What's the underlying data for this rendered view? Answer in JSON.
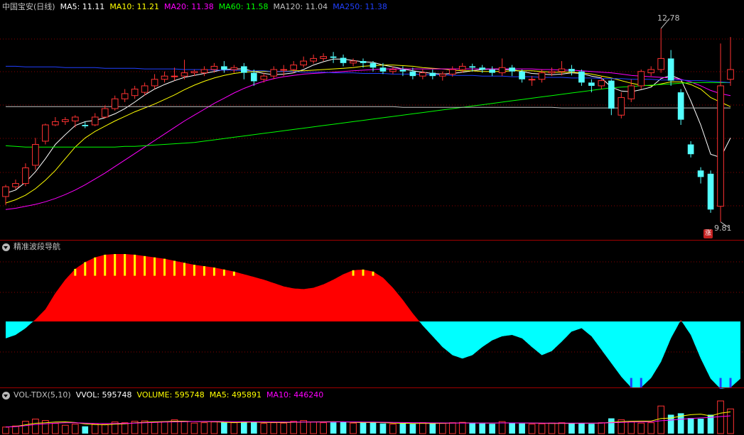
{
  "main_panel": {
    "title": "中国宝安(日线)",
    "ma_labels": [
      {
        "text": "MA5: 11.11",
        "color": "#ffffff"
      },
      {
        "text": "MA10: 11.21",
        "color": "#ffff00"
      },
      {
        "text": "MA20: 11.38",
        "color": "#ff00ff"
      },
      {
        "text": "MA60: 11.58",
        "color": "#00ff00"
      },
      {
        "text": "MA120: 11.04",
        "color": "#c0c0c0"
      },
      {
        "text": "MA250: 11.38",
        "color": "#2040ff"
      }
    ],
    "high_label": "12.78",
    "low_label": "9.81",
    "badge_text": "涨"
  },
  "indicator_panel": {
    "title": "精准波段导航"
  },
  "volume_panel": {
    "labels": [
      {
        "text": "VOL-TDX(5,10)",
        "color": "#c0c0c0"
      },
      {
        "text": "VVOL: 595748",
        "color": "#ffffff"
      },
      {
        "text": "VOLUME: 595748",
        "color": "#ffff00"
      },
      {
        "text": "MA5: 495891",
        "color": "#ffff00"
      },
      {
        "text": "MA10: 446240",
        "color": "#ff00ff"
      }
    ]
  },
  "colors": {
    "up": "#ff3232",
    "down": "#54ffff",
    "grid": "#8a0000",
    "wave_positive": "#ff0000",
    "wave_negative": "#00ffff",
    "wave_stripe_top": "#ffff00",
    "wave_stripe_bottom": "#1e3cff"
  },
  "chart_data": {
    "type": "candlestick",
    "ylim": [
      9.6,
      13.0
    ],
    "candles": [
      [
        10.2,
        10.35,
        10.38,
        10.07
      ],
      [
        10.35,
        10.4,
        10.46,
        10.31
      ],
      [
        10.4,
        10.64,
        10.71,
        10.36
      ],
      [
        10.68,
        11.0,
        11.1,
        10.61
      ],
      [
        11.05,
        11.3,
        11.32,
        11.0
      ],
      [
        11.3,
        11.35,
        11.42,
        11.28
      ],
      [
        11.35,
        11.38,
        11.42,
        11.3
      ],
      [
        11.36,
        11.42,
        11.45,
        11.26
      ],
      [
        11.3,
        11.28,
        11.35,
        11.25
      ],
      [
        11.3,
        11.42,
        11.48,
        11.28
      ],
      [
        11.42,
        11.55,
        11.6,
        11.4
      ],
      [
        11.55,
        11.7,
        11.75,
        11.52
      ],
      [
        11.7,
        11.78,
        11.85,
        11.65
      ],
      [
        11.75,
        11.85,
        11.9,
        11.7
      ],
      [
        11.8,
        11.9,
        11.95,
        11.75
      ],
      [
        11.9,
        12.0,
        12.08,
        11.85
      ],
      [
        12.0,
        12.05,
        12.12,
        11.95
      ],
      [
        12.05,
        12.05,
        12.18,
        11.98
      ],
      [
        12.05,
        12.1,
        12.3,
        12.0
      ],
      [
        12.1,
        12.12,
        12.15,
        12.05
      ],
      [
        12.1,
        12.15,
        12.2,
        12.05
      ],
      [
        12.15,
        12.2,
        12.25,
        12.1
      ],
      [
        12.2,
        12.15,
        12.28,
        12.1
      ],
      [
        12.15,
        12.18,
        12.22,
        12.1
      ],
      [
        12.2,
        12.1,
        12.25,
        12.0
      ],
      [
        12.1,
        11.97,
        12.15,
        11.9
      ],
      [
        12.0,
        12.05,
        12.1,
        11.95
      ],
      [
        12.05,
        12.15,
        12.2,
        12.0
      ],
      [
        12.15,
        12.15,
        12.22,
        12.05
      ],
      [
        12.15,
        12.22,
        12.28,
        12.1
      ],
      [
        12.22,
        12.28,
        12.35,
        12.18
      ],
      [
        12.28,
        12.32,
        12.38,
        12.24
      ],
      [
        12.32,
        12.35,
        12.4,
        12.28
      ],
      [
        12.35,
        12.33,
        12.42,
        12.25
      ],
      [
        12.33,
        12.25,
        12.38,
        12.2
      ],
      [
        12.25,
        12.28,
        12.32,
        12.2
      ],
      [
        12.28,
        12.25,
        12.32,
        12.18
      ],
      [
        12.25,
        12.18,
        12.28,
        12.12
      ],
      [
        12.18,
        12.12,
        12.25,
        12.08
      ],
      [
        12.12,
        12.15,
        12.2,
        12.08
      ],
      [
        12.15,
        12.12,
        12.2,
        12.05
      ],
      [
        12.12,
        12.05,
        12.18,
        12.0
      ],
      [
        12.05,
        12.1,
        12.15,
        12.0
      ],
      [
        12.1,
        12.05,
        12.15,
        12.0
      ],
      [
        12.05,
        12.08,
        12.12,
        11.98
      ],
      [
        12.08,
        12.15,
        12.2,
        12.04
      ],
      [
        12.15,
        12.2,
        12.25,
        12.1
      ],
      [
        12.2,
        12.18,
        12.24,
        12.12
      ],
      [
        12.18,
        12.15,
        12.22,
        12.1
      ],
      [
        12.15,
        12.1,
        12.2,
        12.05
      ],
      [
        12.1,
        12.18,
        12.32,
        12.05
      ],
      [
        12.18,
        12.12,
        12.22,
        12.05
      ],
      [
        12.12,
        12.0,
        12.15,
        11.95
      ],
      [
        12.0,
        12.0,
        12.05,
        11.9
      ],
      [
        12.0,
        12.1,
        12.15,
        11.95
      ],
      [
        12.1,
        12.12,
        12.18,
        12.05
      ],
      [
        12.12,
        12.16,
        12.28,
        12.06
      ],
      [
        12.16,
        12.12,
        12.22,
        12.06
      ],
      [
        12.12,
        11.95,
        12.15,
        11.9
      ],
      [
        11.95,
        11.9,
        12.0,
        11.8
      ],
      [
        11.9,
        11.98,
        12.05,
        11.85
      ],
      [
        11.98,
        11.55,
        12.0,
        11.45
      ],
      [
        11.45,
        11.72,
        11.8,
        11.4
      ],
      [
        11.7,
        11.9,
        12.0,
        11.65
      ],
      [
        11.9,
        12.12,
        12.15,
        11.85
      ],
      [
        12.1,
        12.15,
        12.2,
        12.05
      ],
      [
        12.15,
        12.32,
        12.78,
        12.1
      ],
      [
        12.32,
        11.98,
        12.45,
        11.9
      ],
      [
        11.8,
        11.38,
        11.85,
        11.3
      ],
      [
        11.0,
        10.85,
        11.05,
        10.8
      ],
      [
        10.6,
        10.5,
        10.65,
        10.4
      ],
      [
        10.55,
        10.0,
        10.6,
        9.95
      ],
      [
        10.05,
        11.9,
        12.55,
        9.81
      ],
      [
        12.0,
        12.15,
        12.65,
        11.9
      ]
    ],
    "ma_series": [
      {
        "name": "MA5",
        "color": "#ffffff",
        "values": [
          10.25,
          10.3,
          10.42,
          10.58,
          10.78,
          11.0,
          11.15,
          11.29,
          11.35,
          11.37,
          11.41,
          11.47,
          11.55,
          11.65,
          11.76,
          11.85,
          11.92,
          11.98,
          12.03,
          12.06,
          12.09,
          12.12,
          12.15,
          12.16,
          12.16,
          12.12,
          12.09,
          12.07,
          12.08,
          12.1,
          12.15,
          12.22,
          12.27,
          12.31,
          12.31,
          12.29,
          12.27,
          12.26,
          12.22,
          12.19,
          12.16,
          12.13,
          12.11,
          12.09,
          12.08,
          12.09,
          12.11,
          12.13,
          12.15,
          12.16,
          12.15,
          12.15,
          12.12,
          12.09,
          12.08,
          12.07,
          12.08,
          12.1,
          12.09,
          12.05,
          12.02,
          11.88,
          11.82,
          11.81,
          11.84,
          11.88,
          12.01,
          12.06,
          12.0,
          11.67,
          11.3,
          10.85,
          10.8,
          11.1
        ]
      },
      {
        "name": "MA10",
        "color": "#ffff00",
        "values": [
          10.1,
          10.15,
          10.22,
          10.32,
          10.45,
          10.6,
          10.78,
          10.96,
          11.1,
          11.2,
          11.28,
          11.36,
          11.43,
          11.5,
          11.56,
          11.62,
          11.69,
          11.76,
          11.84,
          11.91,
          11.97,
          12.02,
          12.06,
          12.09,
          12.11,
          12.12,
          12.12,
          12.12,
          12.12,
          12.13,
          12.13,
          12.14,
          12.15,
          12.16,
          12.17,
          12.18,
          12.2,
          12.21,
          12.22,
          12.22,
          12.21,
          12.2,
          12.18,
          12.17,
          12.16,
          12.14,
          12.13,
          12.13,
          12.12,
          12.12,
          12.12,
          12.13,
          12.13,
          12.13,
          12.12,
          12.11,
          12.11,
          12.11,
          12.1,
          12.08,
          12.05,
          12.02,
          11.98,
          11.94,
          11.91,
          11.9,
          11.93,
          11.96,
          11.96,
          11.92,
          11.85,
          11.72,
          11.65,
          11.58
        ]
      },
      {
        "name": "MA20",
        "color": "#ff00ff",
        "values": [
          10.0,
          10.02,
          10.05,
          10.08,
          10.12,
          10.17,
          10.23,
          10.3,
          10.38,
          10.47,
          10.56,
          10.66,
          10.76,
          10.86,
          10.96,
          11.06,
          11.16,
          11.26,
          11.36,
          11.45,
          11.54,
          11.63,
          11.71,
          11.79,
          11.86,
          11.92,
          11.97,
          12.01,
          12.04,
          12.06,
          12.08,
          12.09,
          12.1,
          12.11,
          12.12,
          12.13,
          12.14,
          12.15,
          12.16,
          12.16,
          12.16,
          12.16,
          12.16,
          12.16,
          12.16,
          12.16,
          12.16,
          12.16,
          12.16,
          12.16,
          12.16,
          12.16,
          12.16,
          12.16,
          12.15,
          12.15,
          12.14,
          12.14,
          12.13,
          12.12,
          12.11,
          12.1,
          12.08,
          12.06,
          12.05,
          12.04,
          12.03,
          12.02,
          12.0,
          11.96,
          11.9,
          11.83,
          11.78,
          11.75
        ]
      },
      {
        "name": "MA60",
        "color": "#00ff00",
        "values": [
          10.98,
          10.97,
          10.96,
          10.96,
          10.96,
          10.96,
          10.96,
          10.96,
          10.96,
          10.96,
          10.96,
          10.96,
          10.97,
          10.97,
          10.98,
          10.99,
          11.0,
          11.01,
          11.02,
          11.03,
          11.05,
          11.07,
          11.09,
          11.11,
          11.13,
          11.15,
          11.17,
          11.19,
          11.21,
          11.23,
          11.25,
          11.27,
          11.29,
          11.31,
          11.33,
          11.35,
          11.37,
          11.39,
          11.41,
          11.43,
          11.45,
          11.47,
          11.49,
          11.51,
          11.53,
          11.55,
          11.57,
          11.59,
          11.61,
          11.63,
          11.65,
          11.67,
          11.69,
          11.71,
          11.73,
          11.75,
          11.77,
          11.79,
          11.81,
          11.83,
          11.85,
          11.87,
          11.88,
          11.89,
          11.9,
          11.91,
          11.92,
          11.93,
          11.94,
          11.95,
          11.95,
          11.95,
          11.95,
          11.95
        ]
      },
      {
        "name": "MA120",
        "color": "#c0c0c0",
        "values": [
          11.58,
          11.58,
          11.58,
          11.58,
          11.58,
          11.58,
          11.58,
          11.58,
          11.58,
          11.58,
          11.58,
          11.58,
          11.58,
          11.58,
          11.58,
          11.58,
          11.58,
          11.58,
          11.58,
          11.58,
          11.58,
          11.58,
          11.58,
          11.58,
          11.58,
          11.58,
          11.58,
          11.58,
          11.58,
          11.58,
          11.58,
          11.58,
          11.58,
          11.58,
          11.58,
          11.58,
          11.58,
          11.58,
          11.58,
          11.58,
          11.57,
          11.57,
          11.57,
          11.57,
          11.57,
          11.57,
          11.57,
          11.57,
          11.57,
          11.57,
          11.57,
          11.57,
          11.57,
          11.57,
          11.57,
          11.57,
          11.56,
          11.56,
          11.56,
          11.56,
          11.56,
          11.56,
          11.56,
          11.56,
          11.56,
          11.56,
          11.56,
          11.56,
          11.56,
          11.56,
          11.56,
          11.56,
          11.56,
          11.56
        ]
      },
      {
        "name": "MA250",
        "color": "#2040ff",
        "values": [
          12.2,
          12.2,
          12.19,
          12.19,
          12.19,
          12.19,
          12.18,
          12.18,
          12.18,
          12.18,
          12.17,
          12.17,
          12.17,
          12.17,
          12.16,
          12.16,
          12.16,
          12.16,
          12.15,
          12.15,
          12.15,
          12.14,
          12.14,
          12.14,
          12.13,
          12.13,
          12.13,
          12.12,
          12.12,
          12.12,
          12.11,
          12.11,
          12.11,
          12.1,
          12.1,
          12.1,
          12.09,
          12.09,
          12.09,
          12.08,
          12.08,
          12.08,
          12.07,
          12.07,
          12.07,
          12.06,
          12.06,
          12.06,
          12.05,
          12.05,
          12.05,
          12.04,
          12.04,
          12.04,
          12.03,
          12.03,
          12.03,
          12.02,
          12.02,
          12.02,
          12.01,
          12.01,
          12.01,
          12.0,
          12.0,
          12.0,
          11.99,
          11.99,
          11.99,
          11.98,
          11.98,
          11.97,
          11.96,
          11.95
        ]
      }
    ],
    "wave_values": [
      -0.25,
      -0.2,
      -0.1,
      0.03,
      0.18,
      0.42,
      0.62,
      0.78,
      0.88,
      0.95,
      0.99,
      1.0,
      1.0,
      0.99,
      0.97,
      0.95,
      0.93,
      0.9,
      0.87,
      0.84,
      0.82,
      0.8,
      0.77,
      0.74,
      0.7,
      0.66,
      0.62,
      0.57,
      0.52,
      0.49,
      0.48,
      0.5,
      0.55,
      0.62,
      0.7,
      0.76,
      0.77,
      0.74,
      0.65,
      0.5,
      0.32,
      0.12,
      -0.06,
      -0.22,
      -0.38,
      -0.5,
      -0.55,
      -0.5,
      -0.38,
      -0.28,
      -0.22,
      -0.2,
      -0.25,
      -0.38,
      -0.5,
      -0.44,
      -0.3,
      -0.15,
      -0.1,
      -0.22,
      -0.42,
      -0.62,
      -0.82,
      -0.98,
      -0.98,
      -0.84,
      -0.6,
      -0.25,
      0.02,
      -0.2,
      -0.55,
      -0.85,
      -1.0,
      -0.98,
      -0.85
    ],
    "volumes": [
      180000,
      210000,
      340000,
      400000,
      360000,
      280000,
      230000,
      260000,
      200000,
      270000,
      250000,
      320000,
      300000,
      340000,
      350000,
      310000,
      330000,
      380000,
      340000,
      290000,
      300000,
      320000,
      310000,
      300000,
      330000,
      320000,
      280000,
      300000,
      290000,
      340000,
      360000,
      320000,
      300000,
      310000,
      330000,
      290000,
      300000,
      310000,
      280000,
      260000,
      280000,
      270000,
      300000,
      290000,
      280000,
      300000,
      310000,
      290000,
      280000,
      270000,
      330000,
      300000,
      280000,
      260000,
      270000,
      290000,
      300000,
      280000,
      290000,
      270000,
      300000,
      420000,
      380000,
      330000,
      290000,
      300000,
      760000,
      520000,
      560000,
      430000,
      410000,
      520000,
      900000,
      680000
    ],
    "volume_ma5": [
      180000,
      195000,
      243000,
      283000,
      298000,
      318000,
      322000,
      306000,
      266000,
      248000,
      242000,
      260000,
      268000,
      296000,
      312000,
      324000,
      330000,
      342000,
      342000,
      330000,
      328000,
      326000,
      312000,
      304000,
      312000,
      316000,
      308000,
      310000,
      304000,
      312000,
      318000,
      322000,
      324000,
      326000,
      324000,
      312000,
      306000,
      310000,
      304000,
      290000,
      286000,
      280000,
      282000,
      280000,
      284000,
      288000,
      296000,
      294000,
      292000,
      290000,
      296000,
      294000,
      292000,
      288000,
      286000,
      280000,
      282000,
      282000,
      286000,
      286000,
      288000,
      312000,
      330000,
      340000,
      344000,
      344000,
      416000,
      428000,
      482000,
      520000,
      536000,
      488000,
      564000,
      598000
    ],
    "volume_ma10": [
      180000,
      190000,
      220000,
      250000,
      270000,
      290000,
      300000,
      300000,
      290000,
      280000,
      275000,
      278000,
      282000,
      290000,
      298000,
      308000,
      316000,
      322000,
      328000,
      332000,
      334000,
      334000,
      332000,
      328000,
      326000,
      324000,
      322000,
      320000,
      318000,
      316000,
      316000,
      316000,
      318000,
      320000,
      322000,
      320000,
      318000,
      316000,
      314000,
      310000,
      306000,
      302000,
      298000,
      296000,
      294000,
      292000,
      292000,
      292000,
      292000,
      292000,
      294000,
      294000,
      294000,
      292000,
      290000,
      290000,
      290000,
      290000,
      290000,
      290000,
      292000,
      300000,
      308000,
      316000,
      320000,
      324000,
      354000,
      372000,
      396000,
      414000,
      432000,
      446000,
      470000,
      490000
    ]
  }
}
